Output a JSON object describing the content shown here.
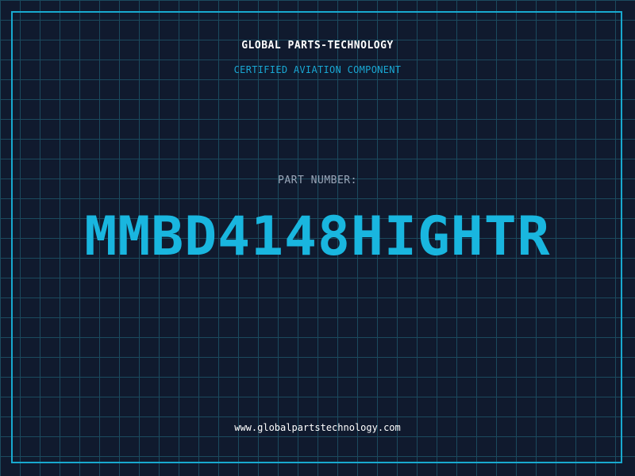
{
  "header": {
    "brand_name": "GLOBAL PARTS-TECHNOLOGY",
    "tagline": "CERTIFIED AVIATION COMPONENT"
  },
  "part": {
    "label": "PART NUMBER:",
    "number": "MMBD4148HIGHTR"
  },
  "footer": {
    "website": "www.globalpartstechnology.com"
  },
  "colors": {
    "background": "#101a2e",
    "grid": "#1b4a5e",
    "accent": "#19b6df",
    "frame": "#18a9cf",
    "label": "#9aa6b8",
    "text": "#ffffff"
  }
}
